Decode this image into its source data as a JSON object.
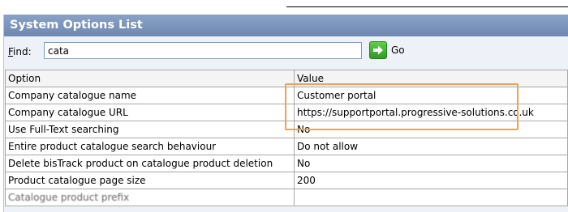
{
  "panel": {
    "title": "System Options List"
  },
  "find": {
    "label_underlined": "F",
    "label_rest": "ind:",
    "value": "cata",
    "go_label": "Go"
  },
  "table": {
    "headers": [
      "Option",
      "Value"
    ],
    "rows": [
      {
        "option": "Company catalogue name",
        "value": "Customer portal"
      },
      {
        "option": "Company catalogue URL",
        "value": "https://supportportal.progressive-solutions.co.uk"
      },
      {
        "option": "Use Full-Text searching",
        "value": "No"
      },
      {
        "option": "Entire product catalogue search behaviour",
        "value": "Do not allow"
      },
      {
        "option": "Delete bisTrack product on catalogue product deletion",
        "value": "No"
      },
      {
        "option": "Product catalogue page size",
        "value": "200"
      },
      {
        "option": "Catalogue product prefix",
        "value": ""
      }
    ]
  },
  "colors": {
    "title_bar": "#7b93ba",
    "highlight": "#f0a050",
    "go_icon": "#3fb332"
  },
  "icons": {
    "go": "green-arrow-right-icon"
  }
}
